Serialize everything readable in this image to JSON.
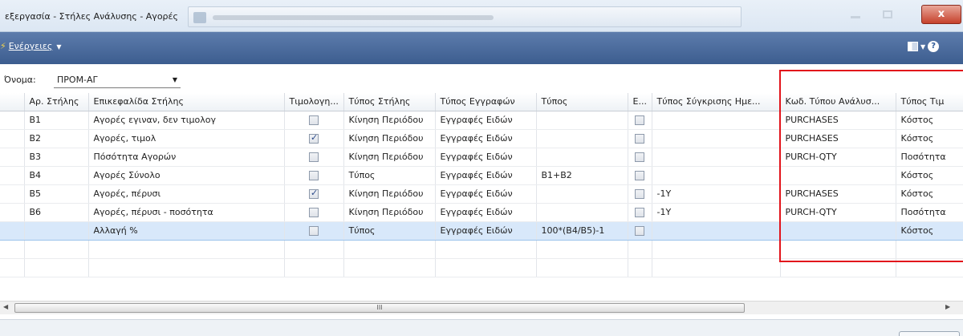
{
  "window": {
    "title": "εξεργασία - Στήλες Ανάλυσης - Αγορές",
    "close_label": "x"
  },
  "actionbar": {
    "actions_label": "Ενέργειες",
    "help_label": "?"
  },
  "name_field": {
    "label": "Όνομα:",
    "value": "ΠΡΟΜ-ΑΓ"
  },
  "grid": {
    "columns": [
      "",
      "Αρ. Στήλης",
      "Επικεφαλίδα Στήλης",
      "Τιμολογη...",
      "Τύπος Στήλης",
      "Τύπος Εγγραφών",
      "Τύπος",
      "Ε...",
      "Τύπος Σύγκρισης Ημε...",
      "Κωδ. Τύπου Ανάλυσ...",
      "Τύπος Τιμ"
    ],
    "rows": [
      {
        "no": "B1",
        "heading": "Αγορές εγιναν, δεν τιμολογ",
        "invoiced": false,
        "col_type": "Κίνηση Περιόδου",
        "entry_type": "Εγγραφές Ειδών",
        "formula": "",
        "e": false,
        "compare": "",
        "analysis_code": "PURCHASES",
        "value_type": "Κόστος"
      },
      {
        "no": "B2",
        "heading": "Αγορές, τιμολ",
        "invoiced": true,
        "col_type": "Κίνηση Περιόδου",
        "entry_type": "Εγγραφές Ειδών",
        "formula": "",
        "e": false,
        "compare": "",
        "analysis_code": "PURCHASES",
        "value_type": "Κόστος"
      },
      {
        "no": "B3",
        "heading": "Πόσότητα Αγορών",
        "invoiced": false,
        "col_type": "Κίνηση Περιόδου",
        "entry_type": "Εγγραφές Ειδών",
        "formula": "",
        "e": false,
        "compare": "",
        "analysis_code": "PURCH-QTY",
        "value_type": "Ποσότητα"
      },
      {
        "no": "B4",
        "heading": "Αγορές Σύνολο",
        "invoiced": false,
        "col_type": "Τύπος",
        "entry_type": "Εγγραφές Ειδών",
        "formula": "B1+B2",
        "e": false,
        "compare": "",
        "analysis_code": "",
        "value_type": "Κόστος"
      },
      {
        "no": "B5",
        "heading": "Αγορές, πέρυσι",
        "invoiced": true,
        "col_type": "Κίνηση Περιόδου",
        "entry_type": "Εγγραφές Ειδών",
        "formula": "",
        "e": false,
        "compare": "-1Y",
        "analysis_code": "PURCHASES",
        "value_type": "Κόστος"
      },
      {
        "no": "B6",
        "heading": "Αγορές, πέρυσι - ποσότητα",
        "invoiced": false,
        "col_type": "Κίνηση Περιόδου",
        "entry_type": "Εγγραφές Ειδών",
        "formula": "",
        "e": false,
        "compare": "-1Y",
        "analysis_code": "PURCH-QTY",
        "value_type": "Ποσότητα"
      },
      {
        "no": "",
        "heading": "Αλλαγή %",
        "invoiced": false,
        "col_type": "Τύπος",
        "entry_type": "Εγγραφές Ειδών",
        "formula": "100*(B4/B5)-1",
        "e": false,
        "compare": "",
        "analysis_code": "",
        "value_type": "Κόστος"
      }
    ],
    "selected_row": 6,
    "empty_rows": 2
  },
  "scrollbar": {
    "thumb_grip": "III"
  },
  "colors": {
    "action_bar": "#4a6a9c",
    "selection": "#d8e8fa",
    "highlight_box": "#e2141b"
  }
}
